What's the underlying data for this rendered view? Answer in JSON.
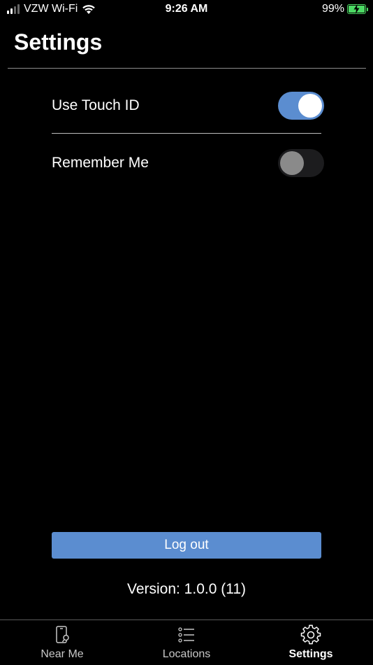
{
  "status_bar": {
    "carrier": "VZW Wi-Fi",
    "time": "9:26 AM",
    "battery": "99%",
    "battery_color": "#4cd964"
  },
  "header": {
    "title": "Settings"
  },
  "settings": {
    "touch_id": {
      "label": "Use Touch ID",
      "enabled": true
    },
    "remember_me": {
      "label": "Remember Me",
      "enabled": false
    }
  },
  "logout_label": "Log out",
  "version": "Version: 1.0.0 (11)",
  "tabs": [
    {
      "label": "Near Me",
      "icon": "phone-location-icon",
      "active": false
    },
    {
      "label": "Locations",
      "icon": "list-icon",
      "active": false
    },
    {
      "label": "Settings",
      "icon": "gear-icon",
      "active": true
    }
  ],
  "colors": {
    "accent": "#5b8dd0",
    "background": "#000000"
  }
}
